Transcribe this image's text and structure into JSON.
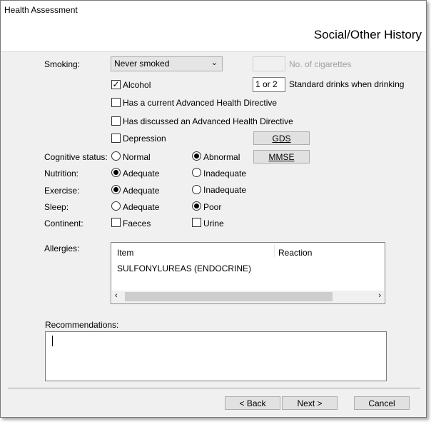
{
  "window": {
    "title": "Health Assessment",
    "section_title": "Social/Other History"
  },
  "smoking": {
    "label": "Smoking:",
    "selected": "Never smoked",
    "cigarettes_value": "",
    "cigarettes_label": "No. of cigarettes"
  },
  "alcohol": {
    "label": "Alcohol",
    "checked": true,
    "drinks_value": "1 or 2",
    "drinks_label": "Standard drinks when drinking"
  },
  "directives": {
    "current_label": "Has a current Advanced Health Directive",
    "discussed_label": "Has discussed an Advanced Health Directive"
  },
  "depression": {
    "label": "Depression",
    "gds_button": "GDS"
  },
  "cognitive": {
    "label": "Cognitive status:",
    "normal": "Normal",
    "abnormal": "Abnormal",
    "selected": "Abnormal",
    "mmse_button": "MMSE"
  },
  "nutrition": {
    "label": "Nutrition:",
    "adequate": "Adequate",
    "inadequate": "Inadequate",
    "selected": "Adequate"
  },
  "exercise": {
    "label": "Exercise:",
    "adequate": "Adequate",
    "inadequate": "Inadequate",
    "selected": "Adequate"
  },
  "sleep": {
    "label": "Sleep:",
    "adequate": "Adequate",
    "poor": "Poor",
    "selected": "Poor"
  },
  "continent": {
    "label": "Continent:",
    "faeces": "Faeces",
    "urine": "Urine"
  },
  "allergies": {
    "label": "Allergies:",
    "columns": [
      "Item",
      "Reaction"
    ],
    "rows": [
      {
        "item": "SULFONYLUREAS (ENDOCRINE)",
        "reaction": ""
      }
    ]
  },
  "recommendations": {
    "label": "Recommendations:",
    "value": ""
  },
  "buttons": {
    "back": "< Back",
    "next": "Next >",
    "cancel": "Cancel"
  },
  "icons": {
    "dropdown": "chevron-down-icon",
    "scroll_left": "chevron-left-icon",
    "scroll_right": "chevron-right-icon",
    "check": "checkmark-icon"
  }
}
